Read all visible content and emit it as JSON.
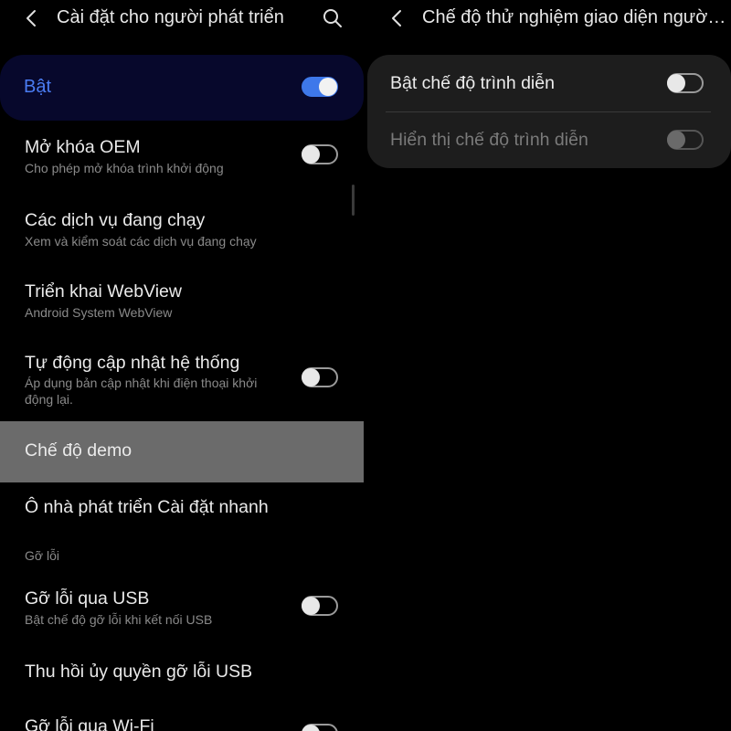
{
  "left_panel": {
    "header": {
      "title": "Cài đặt cho người phát triển"
    },
    "master_toggle": {
      "label": "Bật",
      "state": "on",
      "accent_color": "#4a7cf2"
    },
    "items": [
      {
        "title": "Mở khóa OEM",
        "subtitle": "Cho phép mở khóa trình khởi động",
        "toggle": "off"
      },
      {
        "title": "Các dịch vụ đang chạy",
        "subtitle": "Xem và kiểm soát các dịch vụ đang chạy"
      },
      {
        "title": "Triển khai WebView",
        "subtitle": "Android System WebView"
      },
      {
        "title": "Tự động cập nhật hệ thống",
        "subtitle": "Áp dụng bản cập nhật khi điện thoại khởi động lại.",
        "toggle": "off"
      },
      {
        "title": "Chế độ demo",
        "highlighted": true
      },
      {
        "title": "Ô nhà phát triển Cài đặt nhanh"
      }
    ],
    "section_debug": "Gỡ lỗi",
    "debug_items": [
      {
        "title": "Gỡ lỗi qua USB",
        "subtitle": "Bật chế độ gỡ lỗi khi kết nối USB",
        "toggle": "off"
      },
      {
        "title": "Thu hồi ủy quyền gỡ lỗi USB"
      },
      {
        "title": "Gỡ lỗi qua Wi-Fi",
        "toggle": "off"
      }
    ]
  },
  "right_panel": {
    "header": {
      "title": "Chế độ thử nghiệm giao diện người dùng hệ thống"
    },
    "items": [
      {
        "title": "Bật chế độ trình diễn",
        "toggle": "off",
        "enabled": true
      },
      {
        "title": "Hiển thị chế độ trình diễn",
        "toggle": "off",
        "enabled": false
      }
    ]
  },
  "icons": {
    "back": "chevron-left-icon",
    "search": "search-icon"
  }
}
